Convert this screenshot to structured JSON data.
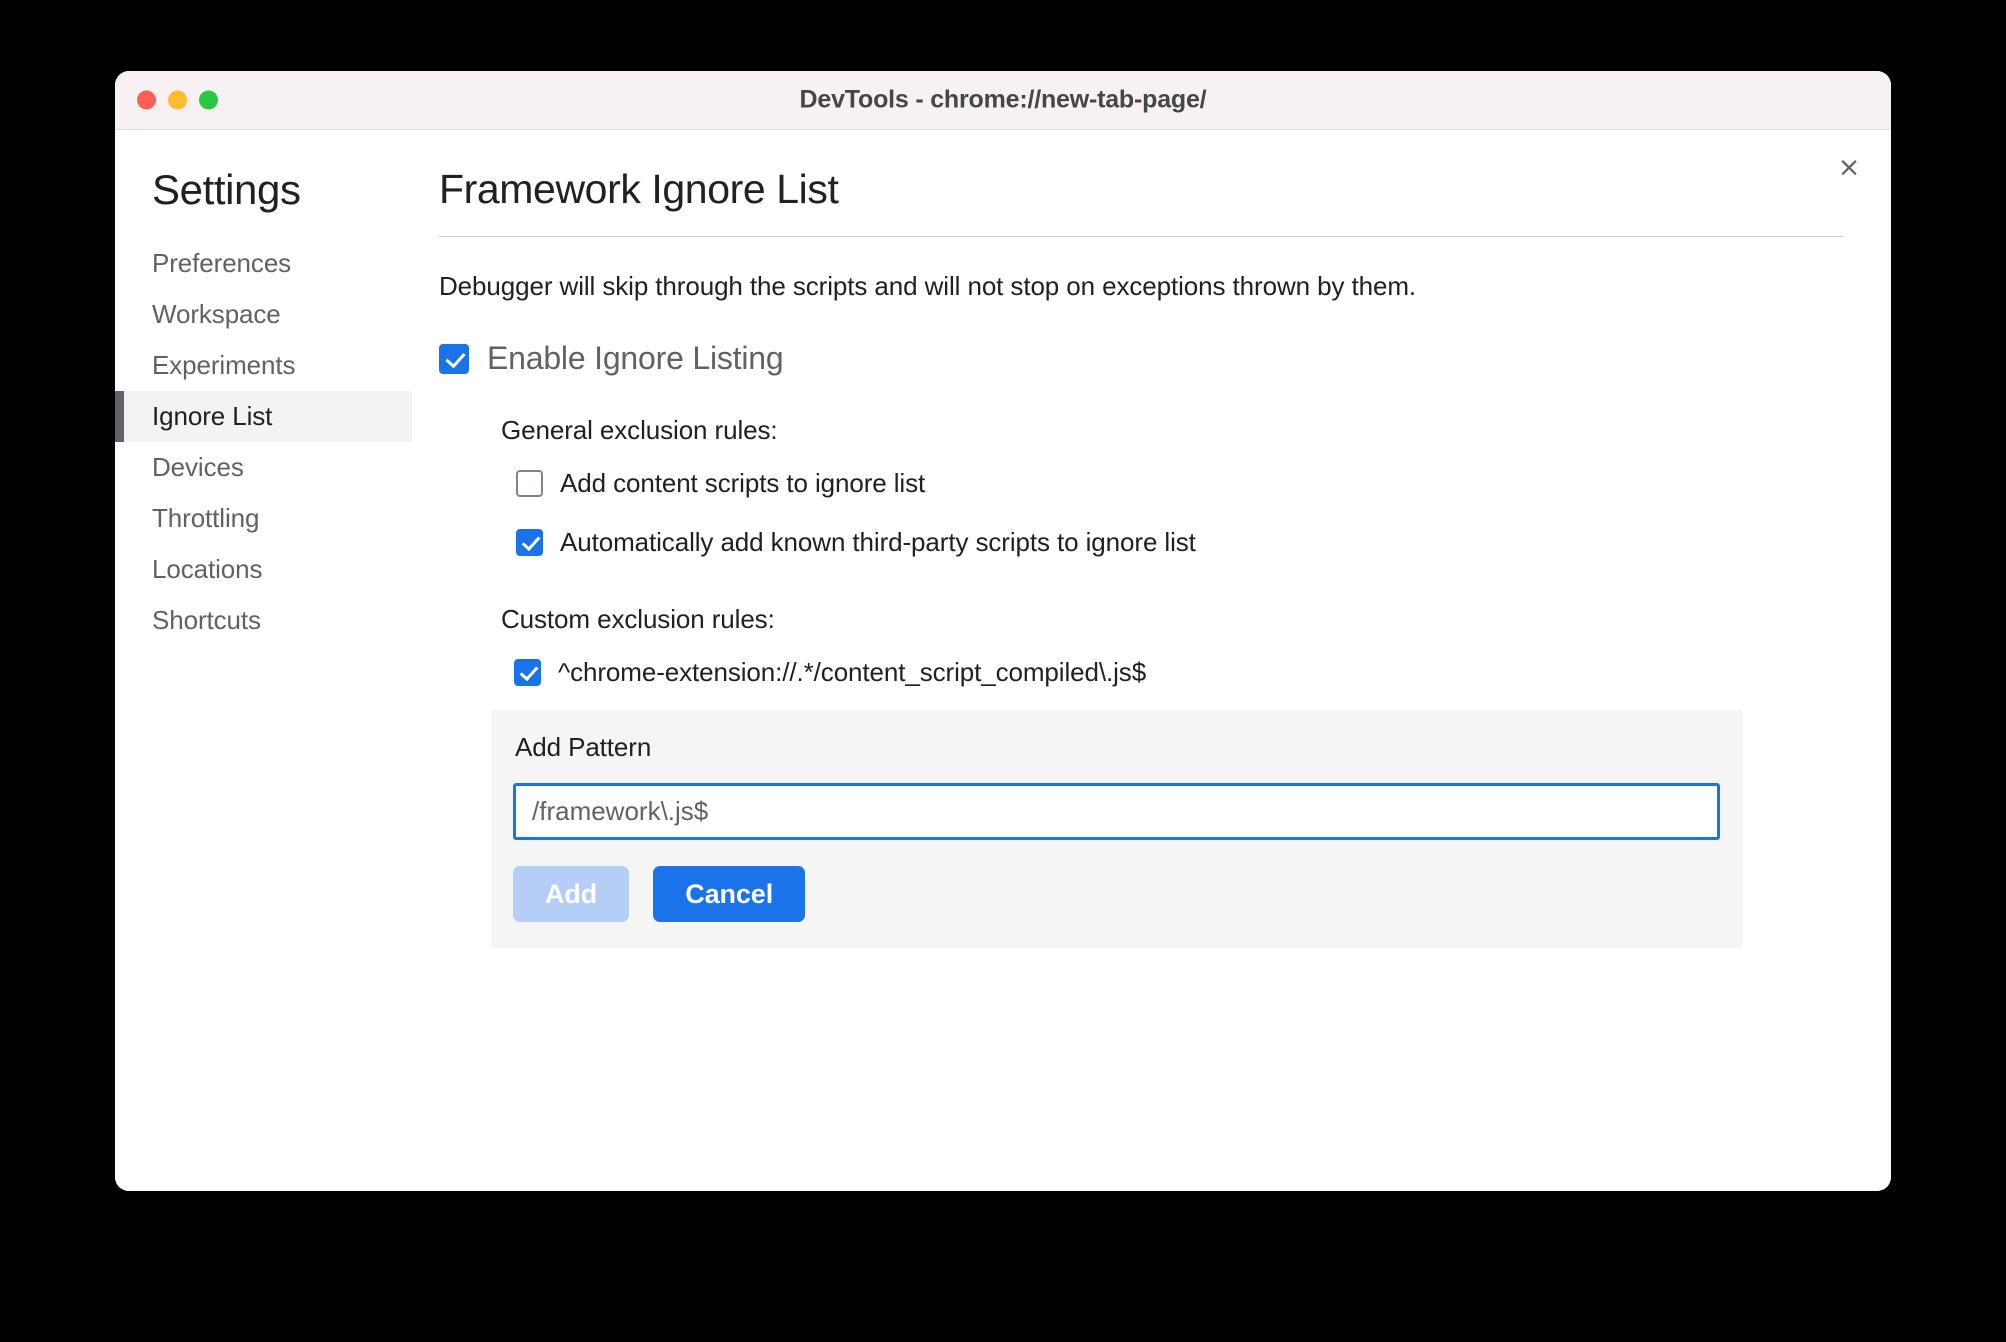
{
  "window": {
    "title": "DevTools - chrome://new-tab-page/",
    "close_label": "×",
    "traffic_lights": [
      "close",
      "minimize",
      "maximize"
    ],
    "accent_color": "#1a73e8",
    "titlebar_color": "#f8f1f3"
  },
  "sidebar": {
    "title": "Settings",
    "items": [
      {
        "label": "Preferences",
        "selected": false
      },
      {
        "label": "Workspace",
        "selected": false
      },
      {
        "label": "Experiments",
        "selected": false
      },
      {
        "label": "Ignore List",
        "selected": true
      },
      {
        "label": "Devices",
        "selected": false
      },
      {
        "label": "Throttling",
        "selected": false
      },
      {
        "label": "Locations",
        "selected": false
      },
      {
        "label": "Shortcuts",
        "selected": false
      }
    ]
  },
  "main": {
    "title": "Framework Ignore List",
    "description": "Debugger will skip through the scripts and will not stop on exceptions thrown by them.",
    "enable_toggle": {
      "label": "Enable Ignore Listing",
      "checked": true
    },
    "general_rules": {
      "label": "General exclusion rules:",
      "items": [
        {
          "label": "Add content scripts to ignore list",
          "checked": false
        },
        {
          "label": "Automatically add known third-party scripts to ignore list",
          "checked": true
        }
      ]
    },
    "custom_rules": {
      "label": "Custom exclusion rules:",
      "items": [
        {
          "label": "^chrome-extension://.*/content_script_compiled\\.js$",
          "checked": true
        }
      ]
    },
    "add_pattern": {
      "title": "Add Pattern",
      "input_value": "/framework\\.js$",
      "input_placeholder": "/framework\\.js$",
      "add_label": "Add",
      "add_disabled": true,
      "cancel_label": "Cancel"
    }
  }
}
